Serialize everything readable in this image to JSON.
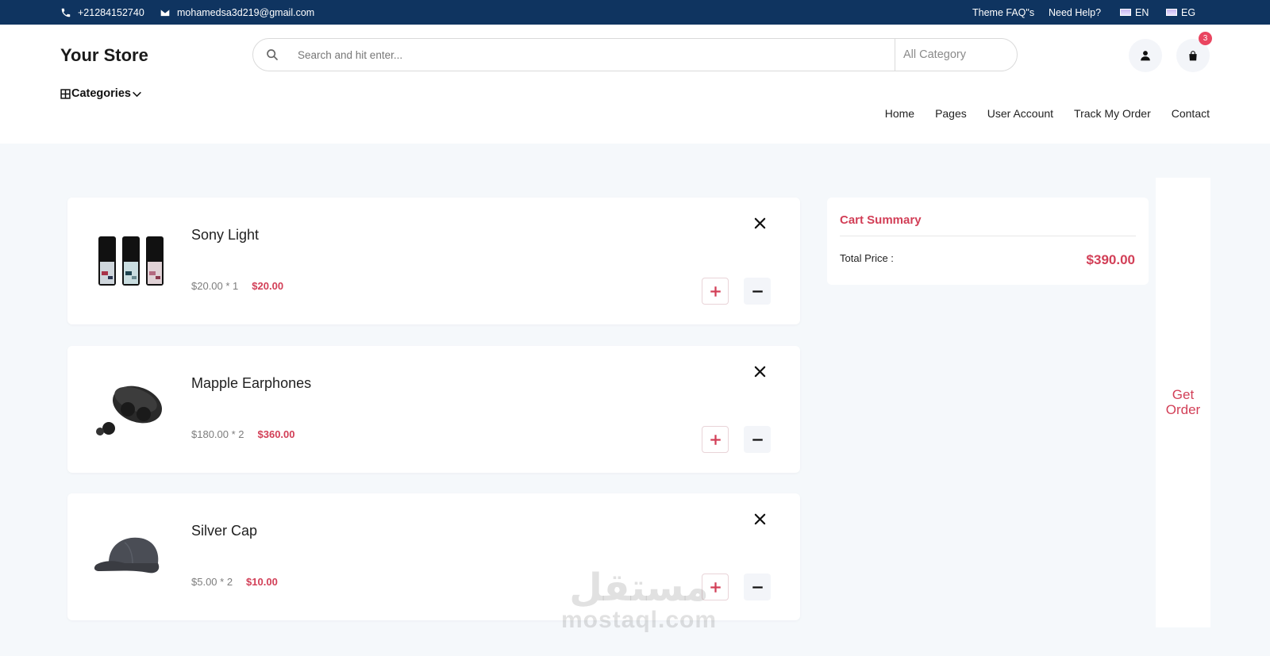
{
  "topbar": {
    "phone": "+21284152740",
    "email": "mohamedsa3d219@gmail.com",
    "links": [
      "Theme FAQ\"s",
      "Need Help?"
    ],
    "langs": [
      "EN",
      "EG"
    ]
  },
  "header": {
    "logo": "Your Store",
    "search_placeholder": "Search and hit enter...",
    "category_select": "All Category",
    "cart_count": "3",
    "categories_label": "Categories"
  },
  "nav": [
    "Home",
    "Pages",
    "User Account",
    "Track My Order",
    "Contact"
  ],
  "cart": {
    "items": [
      {
        "name": "Sony Light",
        "unit": "$20.00 * 1",
        "total": "$20.00"
      },
      {
        "name": "Mapple Earphones",
        "unit": "$180.00 * 2",
        "total": "$360.00"
      },
      {
        "name": "Silver Cap",
        "unit": "$5.00 * 2",
        "total": "$10.00"
      }
    ]
  },
  "summary": {
    "title": "Cart Summary",
    "total_label": "Total Price :",
    "total_value": "$390.00"
  },
  "order_button": "Get Order",
  "watermark": {
    "arabic": "مستقل",
    "latin": "mostaql.com"
  },
  "colors": {
    "topbar": "#0f3460",
    "accent": "#d23f57",
    "badge": "#e94560"
  }
}
